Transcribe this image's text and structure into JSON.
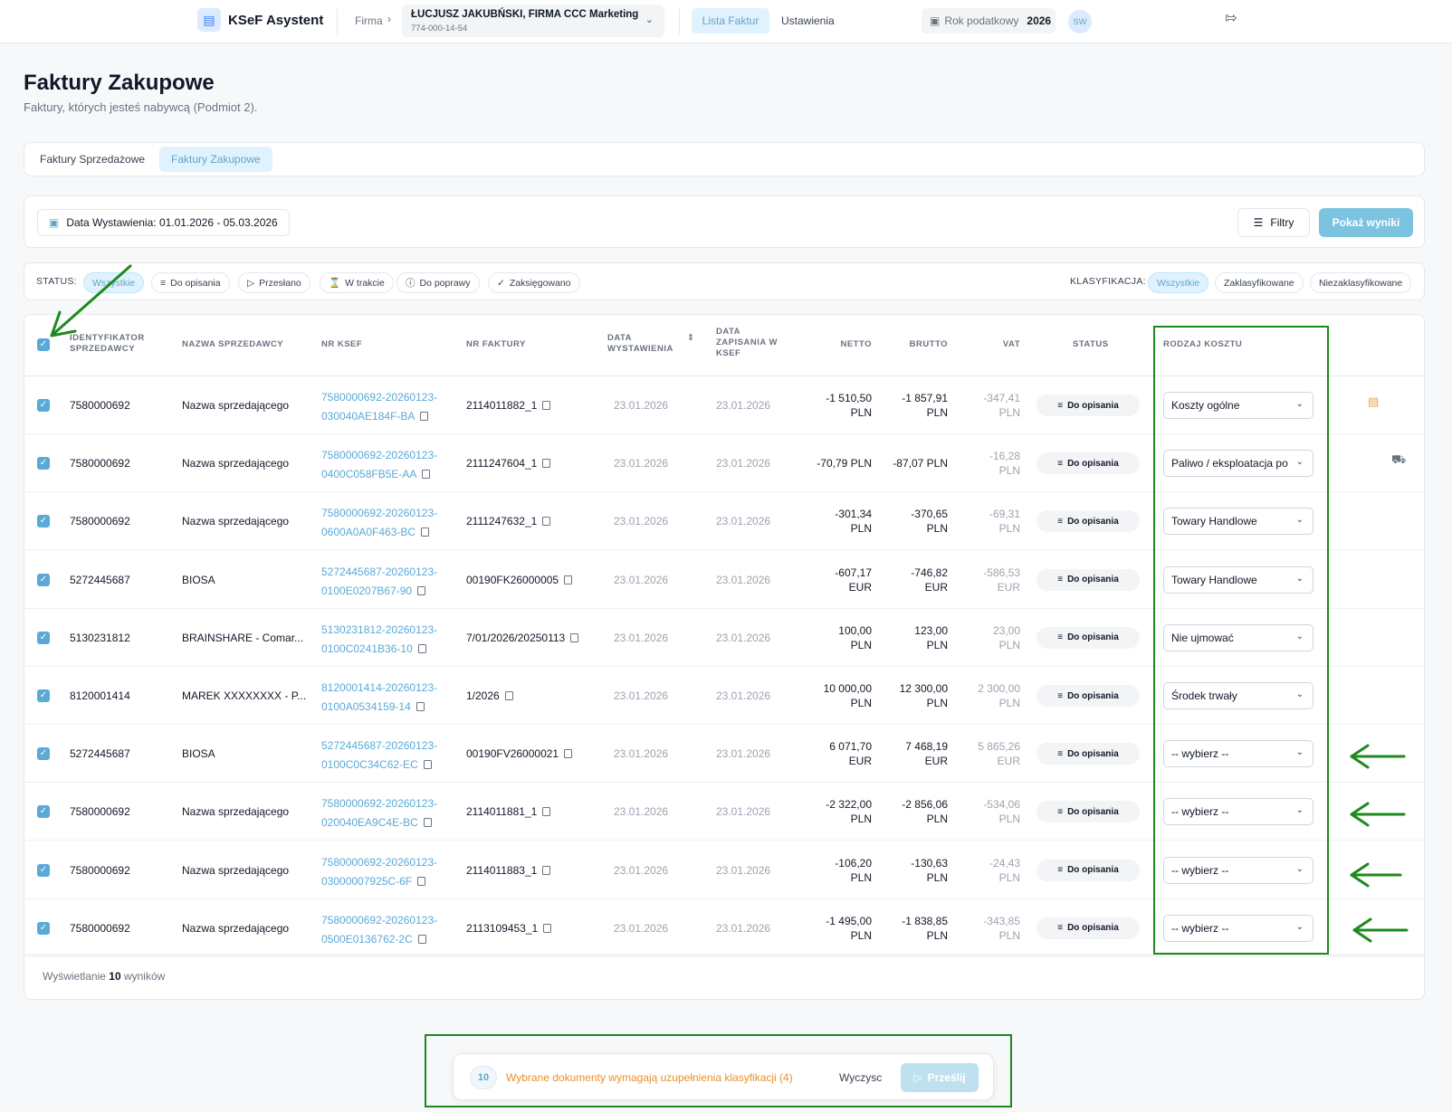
{
  "header": {
    "app_title": "KSeF Asystent",
    "firma_label": "Firma",
    "company_name": "ŁUCJUSZ JAKUBŃSKI, FIRMA CCC Marketing",
    "company_nip": "774-000-14-54",
    "nav_active": "Lista Faktur",
    "nav_settings": "Ustawienia",
    "tax_year_label": "Rok podatkowy",
    "tax_year_value": "2026",
    "avatar_initials": "SW"
  },
  "page": {
    "title": "Faktury Zakupowe",
    "subtitle": "Faktury, których jesteś nabywcą (Podmiot 2)."
  },
  "tabs": [
    {
      "label": "Faktury Sprzedażowe"
    },
    {
      "label": "Faktury Zakupowe"
    }
  ],
  "filters": {
    "date_chip": "Data Wystawienia: 01.01.2026 - 05.03.2026",
    "filters_button": "Filtry",
    "show_results_button": "Pokaż wyniki"
  },
  "status_filter": {
    "label": "STATUS:",
    "pills": [
      "Wszystkie",
      "Do opisania",
      "Przesłano",
      "W trakcie",
      "Do poprawy",
      "Zaksięgowano"
    ]
  },
  "classification_filter": {
    "label": "KLASYFIKACJA:",
    "pills": [
      "Wszystkie",
      "Zaklasyfikowane",
      "Niezaklasyfikowane"
    ]
  },
  "table": {
    "headers": {
      "seller_id": "IDENTYFIKATOR SPRZEDAWCY",
      "seller_name": "NAZWA SPRZEDAWCY",
      "ksef_no": "NR KSEF",
      "invoice_no": "NR FAKTURY",
      "issue_date": "DATA WYSTAWIENIA",
      "ksef_date": "DATA ZAPISANIA W KSEF",
      "net": "NETTO",
      "gross": "BRUTTO",
      "vat": "VAT",
      "status": "STATUS",
      "cost_type": "RODZAJ KOSZTU"
    },
    "rows": [
      {
        "seller_id": "7580000692",
        "seller_name": "Nazwa sprzedającego",
        "ksef_1": "7580000692-20260123-",
        "ksef_2": "030040AE184F-BA",
        "invoice_no": "2114011882_1",
        "issue_date": "23.01.2026",
        "ksef_date": "23.01.2026",
        "net_1": "-1 510,50",
        "net_2": "PLN",
        "gross_1": "-1 857,91",
        "gross_2": "PLN",
        "vat_1": "-347,41",
        "vat_2": "PLN",
        "status": "Do opisania",
        "cost_type": "Koszty ogólne",
        "row_icon": "note-icon"
      },
      {
        "seller_id": "7580000692",
        "seller_name": "Nazwa sprzedającego",
        "ksef_1": "7580000692-20260123-",
        "ksef_2": "0400C058FB5E-AA",
        "invoice_no": "2111247604_1",
        "issue_date": "23.01.2026",
        "ksef_date": "23.01.2026",
        "net_1": "-70,79 PLN",
        "net_2": "",
        "gross_1": "-87,07 PLN",
        "gross_2": "",
        "vat_1": "-16,28",
        "vat_2": "PLN",
        "status": "Do opisania",
        "cost_type": "Paliwo / eksploatacja po",
        "row_icon": "car-icon"
      },
      {
        "seller_id": "7580000692",
        "seller_name": "Nazwa sprzedającego",
        "ksef_1": "7580000692-20260123-",
        "ksef_2": "0600A0A0F463-BC",
        "invoice_no": "2111247632_1",
        "issue_date": "23.01.2026",
        "ksef_date": "23.01.2026",
        "net_1": "-301,34",
        "net_2": "PLN",
        "gross_1": "-370,65",
        "gross_2": "PLN",
        "vat_1": "-69,31",
        "vat_2": "PLN",
        "status": "Do opisania",
        "cost_type": "Towary Handlowe",
        "row_icon": ""
      },
      {
        "seller_id": "5272445687",
        "seller_name": "BIOSA",
        "ksef_1": "5272445687-20260123-",
        "ksef_2": "0100E0207B67-90",
        "invoice_no": "00190FK26000005",
        "issue_date": "23.01.2026",
        "ksef_date": "23.01.2026",
        "net_1": "-607,17",
        "net_2": "EUR",
        "gross_1": "-746,82",
        "gross_2": "EUR",
        "vat_1": "-586,53",
        "vat_2": "EUR",
        "status": "Do opisania",
        "cost_type": "Towary Handlowe",
        "row_icon": ""
      },
      {
        "seller_id": "5130231812",
        "seller_name": "BRAINSHARE - Comar...",
        "ksef_1": "5130231812-20260123-",
        "ksef_2": "0100C0241B36-10",
        "invoice_no": "7/01/2026/20250113",
        "issue_date": "23.01.2026",
        "ksef_date": "23.01.2026",
        "net_1": "100,00",
        "net_2": "PLN",
        "gross_1": "123,00",
        "gross_2": "PLN",
        "vat_1": "23,00",
        "vat_2": "PLN",
        "status": "Do opisania",
        "cost_type": "Nie ujmować",
        "row_icon": ""
      },
      {
        "seller_id": "8120001414",
        "seller_name": "MAREK XXXXXXXX - P...",
        "ksef_1": "8120001414-20260123-",
        "ksef_2": "0100A0534159-14",
        "invoice_no": "1/2026",
        "issue_date": "23.01.2026",
        "ksef_date": "23.01.2026",
        "net_1": "10 000,00",
        "net_2": "PLN",
        "gross_1": "12 300,00",
        "gross_2": "PLN",
        "vat_1": "2 300,00",
        "vat_2": "PLN",
        "status": "Do opisania",
        "cost_type": "Środek trwały",
        "row_icon": ""
      },
      {
        "seller_id": "5272445687",
        "seller_name": "BIOSA",
        "ksef_1": "5272445687-20260123-",
        "ksef_2": "0100C0C34C62-EC",
        "invoice_no": "00190FV26000021",
        "issue_date": "23.01.2026",
        "ksef_date": "23.01.2026",
        "net_1": "6 071,70",
        "net_2": "EUR",
        "gross_1": "7 468,19",
        "gross_2": "EUR",
        "vat_1": "5 865,26",
        "vat_2": "EUR",
        "status": "Do opisania",
        "cost_type": "-- wybierz --",
        "row_icon": ""
      },
      {
        "seller_id": "7580000692",
        "seller_name": "Nazwa sprzedającego",
        "ksef_1": "7580000692-20260123-",
        "ksef_2": "020040EA9C4E-BC",
        "invoice_no": "2114011881_1",
        "issue_date": "23.01.2026",
        "ksef_date": "23.01.2026",
        "net_1": "-2 322,00",
        "net_2": "PLN",
        "gross_1": "-2 856,06",
        "gross_2": "PLN",
        "vat_1": "-534,06",
        "vat_2": "PLN",
        "status": "Do opisania",
        "cost_type": "-- wybierz --",
        "row_icon": ""
      },
      {
        "seller_id": "7580000692",
        "seller_name": "Nazwa sprzedającego",
        "ksef_1": "7580000692-20260123-",
        "ksef_2": "03000007925C-6F",
        "invoice_no": "2114011883_1",
        "issue_date": "23.01.2026",
        "ksef_date": "23.01.2026",
        "net_1": "-106,20",
        "net_2": "PLN",
        "gross_1": "-130,63",
        "gross_2": "PLN",
        "vat_1": "-24,43",
        "vat_2": "PLN",
        "status": "Do opisania",
        "cost_type": "-- wybierz --",
        "row_icon": ""
      },
      {
        "seller_id": "7580000692",
        "seller_name": "Nazwa sprzedającego",
        "ksef_1": "7580000692-20260123-",
        "ksef_2": "0500E0136762-2C",
        "invoice_no": "2113109453_1",
        "issue_date": "23.01.2026",
        "ksef_date": "23.01.2026",
        "net_1": "-1 495,00",
        "net_2": "PLN",
        "gross_1": "-1 838,85",
        "gross_2": "PLN",
        "vat_1": "-343,85",
        "vat_2": "PLN",
        "status": "Do opisania",
        "cost_type": "-- wybierz --",
        "row_icon": ""
      }
    ],
    "footer_prefix": "Wyświetlanie",
    "footer_count": "10",
    "footer_suffix": "wyników"
  },
  "bottom_bar": {
    "count": "10",
    "warning": "Wybrane dokumenty wymagają uzupełnienia klasyfikacji (4)",
    "clear": "Wyczysc",
    "send": "Prześlij"
  },
  "colors": {
    "accent": "#5aa9d6",
    "annotation": "#1c8a1c",
    "warning": "#e8912b"
  }
}
